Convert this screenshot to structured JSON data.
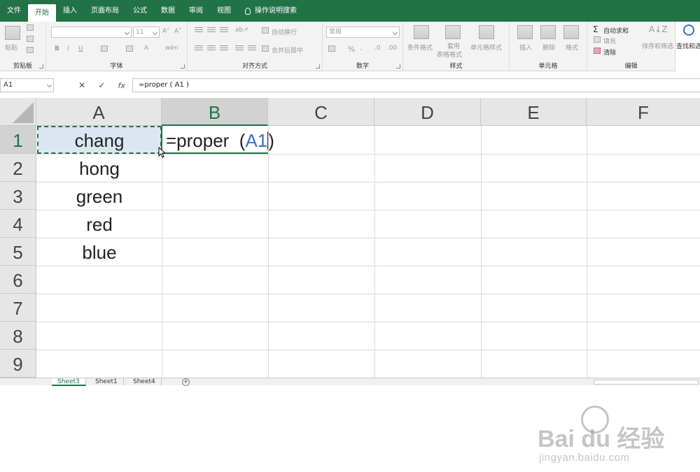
{
  "ribbon": {
    "tabs": [
      "文件",
      "开始",
      "插入",
      "页面布局",
      "公式",
      "数据",
      "审阅",
      "视图"
    ],
    "active_tab": "开始",
    "tell_me": "操作说明搜索",
    "groups": {
      "clipboard": {
        "label": "剪贴板",
        "paste": "粘贴"
      },
      "font": {
        "label": "字体",
        "font_size": "11"
      },
      "alignment": {
        "label": "对齐方式",
        "wrap": "自动换行",
        "merge": "合并后居中"
      },
      "number": {
        "label": "数字",
        "format": "常规",
        "percent": "%"
      },
      "styles": {
        "label": "样式",
        "conditional": "条件格式",
        "table_l1": "套用",
        "table_l2": "表格格式",
        "cell_styles": "单元格样式"
      },
      "cells": {
        "label": "单元格",
        "insert": "插入",
        "delete": "删除",
        "format": "格式"
      },
      "editing": {
        "label": "编辑",
        "autosum": "自动求和",
        "fill": "填充",
        "clear": "清除",
        "sort": "排序和筛选",
        "find": "查找和选"
      }
    }
  },
  "formula_bar": {
    "name_box": "A1",
    "fx": "fx",
    "formula": "=proper ( A1 )"
  },
  "grid": {
    "columns": [
      "A",
      "B",
      "C",
      "D",
      "E",
      "F"
    ],
    "rows": [
      "1",
      "2",
      "3",
      "4",
      "5",
      "6",
      "7",
      "8",
      "9"
    ],
    "cells_A": [
      "chang",
      "hong",
      "green",
      "red",
      "blue"
    ],
    "edit_prefix": "=proper  (",
    "edit_ref": "A1",
    "edit_suffix": ")"
  },
  "sheets": {
    "tabs": [
      "Sheet3",
      "Sheet1",
      "Sheet4"
    ],
    "active": "Sheet3"
  },
  "watermark": {
    "main": "Bai du 经验",
    "sub": "jingyan.baidu.com"
  },
  "colors": {
    "accent": "#217346",
    "ref_blue": "#3b6fc4"
  }
}
